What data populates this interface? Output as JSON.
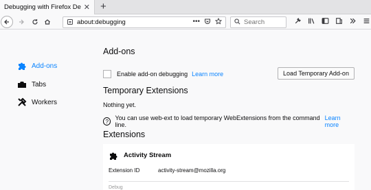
{
  "browser": {
    "tab_title": "Debugging with Firefox Deve",
    "tab_close": "✕",
    "new_tab": "+",
    "url": "about:debugging",
    "url_actions": "•••",
    "search_placeholder": "Search"
  },
  "sidebar": {
    "items": [
      {
        "label": "Add-ons",
        "icon": "puzzle-icon",
        "active": true
      },
      {
        "label": "Tabs",
        "icon": "tab-icon"
      },
      {
        "label": "Workers",
        "icon": "tools-icon"
      }
    ]
  },
  "main": {
    "title": "Add-ons",
    "enable_debugging_label": "Enable add-on debugging",
    "learn_more": "Learn more",
    "load_button": "Load Temporary Add-on",
    "temporary_heading": "Temporary Extensions",
    "nothing_yet": "Nothing yet.",
    "info_text": "You can use web-ext to load temporary WebExtensions from the command line.",
    "info_learn_more": "Learn more",
    "extensions_heading": "Extensions",
    "extension": {
      "name": "Activity Stream",
      "id_label": "Extension ID",
      "id_value": "activity-stream@mozilla.org",
      "debug_label": "Debug"
    }
  },
  "colors": {
    "accent": "#0a84ff",
    "page_bg": "#f9f9fa"
  }
}
